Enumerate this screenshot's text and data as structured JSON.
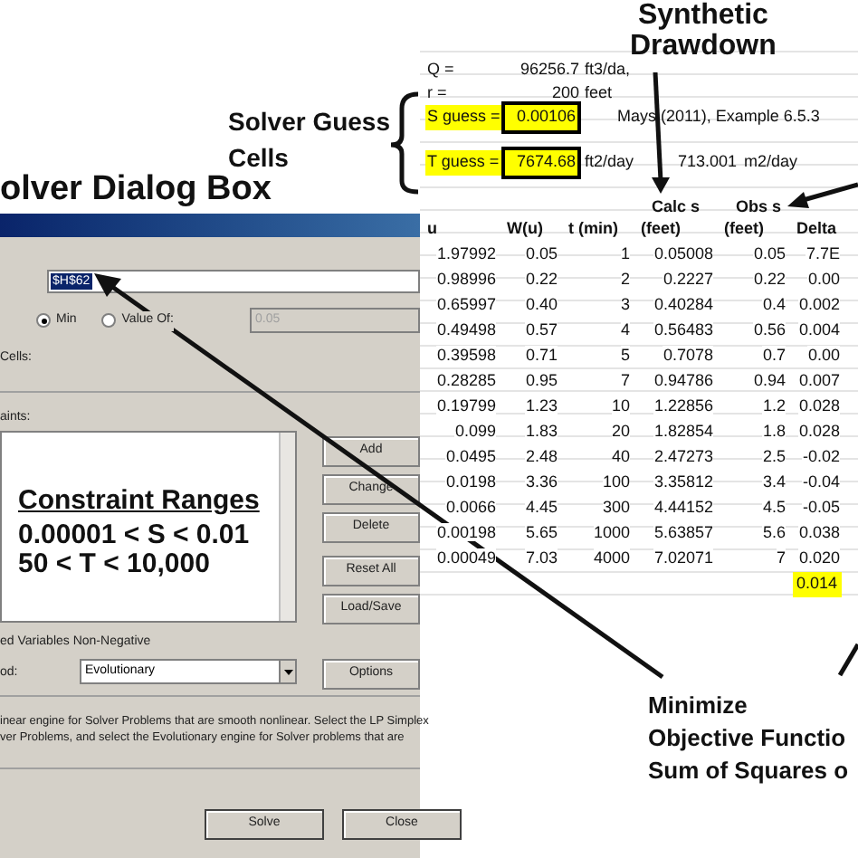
{
  "annotations": {
    "dialog_title": "olver Dialog Box",
    "guess_cells": [
      "Solver Guess",
      "Cells"
    ],
    "synthetic": [
      "Synthetic",
      "Drawdown"
    ],
    "minimize": [
      "Minimize",
      "Objective Functio",
      "Sum of Squares o"
    ]
  },
  "dialog": {
    "objective": "$H$62",
    "radios": [
      {
        "label": "Min",
        "selected": true
      },
      {
        "label": "Value Of:",
        "selected": false
      }
    ],
    "value_of": "0.05",
    "cells_label": "Cells:",
    "constraints_label": "aints:",
    "constraint_note": {
      "title": "Constraint Ranges",
      "lines": [
        "0.00001 < S < 0.01",
        "50 < T < 10,000"
      ]
    },
    "side_buttons": [
      "Add",
      "Change",
      "Delete",
      "Reset All",
      "Load/Save"
    ],
    "nonneg_label": "ed Variables Non-Negative",
    "method_label": "od:",
    "method": "Evolutionary",
    "options_button": "Options",
    "description": [
      "inear engine for Solver Problems that are smooth nonlinear. Select the LP Simplex",
      "ver Problems, and select the Evolutionary engine for Solver problems that are"
    ],
    "bottom_buttons": [
      "Solve",
      "Close"
    ]
  },
  "sheet": {
    "top_rows": [
      {
        "label": "Q =",
        "value": "96256.7",
        "unit": "ft3/da,",
        "highlighted": false
      },
      {
        "label": "r =",
        "value": "200",
        "unit": "feet",
        "highlighted": false
      },
      {
        "label": "S guess =",
        "value": "0.00106",
        "note": "Mays (2011), Example 6.5.3",
        "highlighted": true
      },
      {
        "label": "T guess =",
        "value": "7674.68",
        "unit": "ft2/day",
        "converted": "713.001",
        "converted_unit": "m2/day",
        "highlighted": true
      }
    ],
    "header_top": [
      "Calc s",
      "Obs s"
    ],
    "header": [
      "u",
      "W(u)",
      "t (min)",
      "(feet)",
      "(feet)",
      "Delta"
    ],
    "rows": [
      [
        "1.97992",
        "0.05",
        "1",
        "0.05008",
        "0.05",
        "7.7E"
      ],
      [
        "0.98996",
        "0.22",
        "2",
        "0.2227",
        "0.22",
        "0.00"
      ],
      [
        "0.65997",
        "0.40",
        "3",
        "0.40284",
        "0.4",
        "0.002"
      ],
      [
        "0.49498",
        "0.57",
        "4",
        "0.56483",
        "0.56",
        "0.004"
      ],
      [
        "0.39598",
        "0.71",
        "5",
        "0.7078",
        "0.7",
        "0.00"
      ],
      [
        "0.28285",
        "0.95",
        "7",
        "0.94786",
        "0.94",
        "0.007"
      ],
      [
        "0.19799",
        "1.23",
        "10",
        "1.22856",
        "1.2",
        "0.028"
      ],
      [
        "0.099",
        "1.83",
        "20",
        "1.82854",
        "1.8",
        "0.028"
      ],
      [
        "0.0495",
        "2.48",
        "40",
        "2.47273",
        "2.5",
        "-0.02"
      ],
      [
        "0.0198",
        "3.36",
        "100",
        "3.35812",
        "3.4",
        "-0.04"
      ],
      [
        "0.0066",
        "4.45",
        "300",
        "4.44152",
        "4.5",
        "-0.05"
      ],
      [
        "0.00198",
        "5.65",
        "1000",
        "5.63857",
        "5.6",
        "0.038"
      ],
      [
        "0.00049",
        "7.03",
        "4000",
        "7.02071",
        "7",
        "0.020"
      ]
    ],
    "total": "0.014"
  }
}
